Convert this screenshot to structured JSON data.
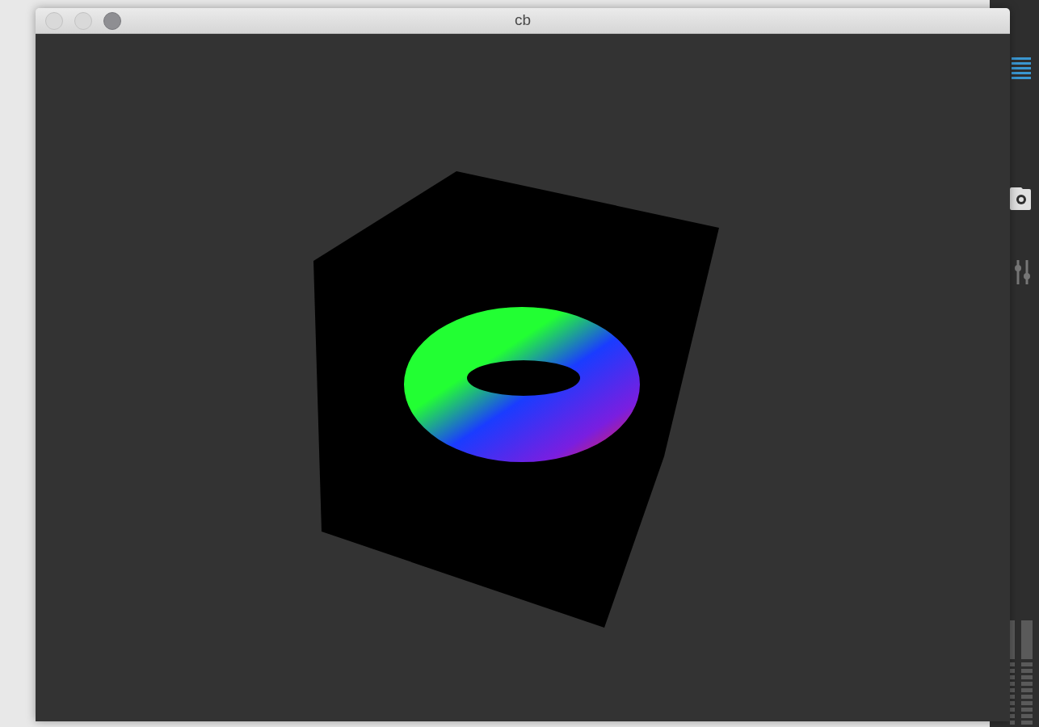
{
  "window": {
    "title": "cb"
  }
}
